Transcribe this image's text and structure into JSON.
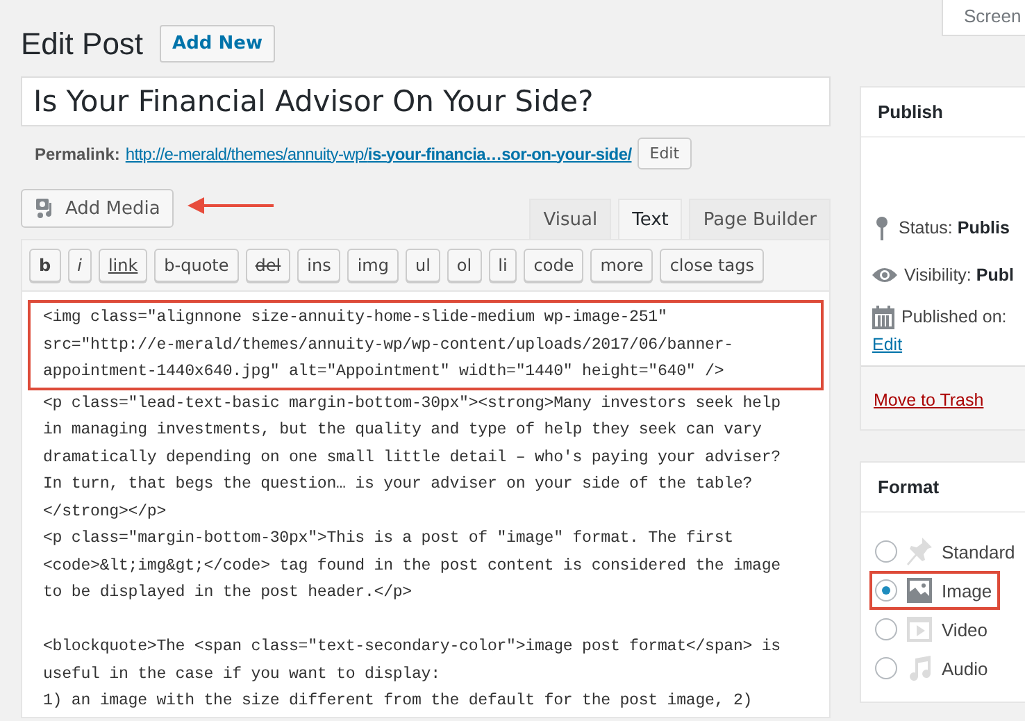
{
  "screen_options_tab": "Screen",
  "heading": {
    "title": "Edit Post",
    "add_new_button": "Add New"
  },
  "post_title": {
    "value": "Is Your Financial Advisor On Your Side?"
  },
  "permalink": {
    "label": "Permalink:",
    "url_base": "http://e-merald/themes/annuity-wp/",
    "url_slug": "is-your-financia…sor-on-your-side/",
    "edit_button": "Edit"
  },
  "add_media_button": "Add Media",
  "editor_tabs": [
    {
      "label": "Visual",
      "selected": false
    },
    {
      "label": "Text",
      "selected": true
    },
    {
      "label": "Page Builder",
      "selected": false
    }
  ],
  "quicktags": [
    {
      "label": "b",
      "kind": "bold"
    },
    {
      "label": "i",
      "kind": "italic"
    },
    {
      "label": "link",
      "kind": "underline"
    },
    {
      "label": "b-quote",
      "kind": "plain"
    },
    {
      "label": "del",
      "kind": "strike"
    },
    {
      "label": "ins",
      "kind": "plain"
    },
    {
      "label": "img",
      "kind": "plain"
    },
    {
      "label": "ul",
      "kind": "plain"
    },
    {
      "label": "ol",
      "kind": "plain"
    },
    {
      "label": "li",
      "kind": "plain"
    },
    {
      "label": "code",
      "kind": "plain"
    },
    {
      "label": "more",
      "kind": "plain"
    },
    {
      "label": "close tags",
      "kind": "plain"
    }
  ],
  "editor": {
    "highlighted_lines": [
      "<img class=\"alignnone size-annuity-home-slide-medium wp-image-251\"",
      "src=\"http://e-merald/themes/annuity-wp/wp-content/uploads/2017/06/banner-",
      "appointment-1440x640.jpg\" alt=\"Appointment\" width=\"1440\" height=\"640\" />"
    ],
    "blocks": [
      [
        "<p class=\"lead-text-basic margin-bottom-30px\"><strong>Many investors seek help",
        "in managing investments, but the quality and type of help they seek can vary",
        "dramatically depending on one small little detail – who's paying your adviser?",
        "In turn, that begs the question… is your adviser on your side of the table?",
        "</strong></p>",
        "<p class=\"margin-bottom-30px\">This is a post of \"image\" format. The first",
        "<code>&lt;img&gt;</code> tag found in the post content is considered the image",
        "to be displayed in the post header.</p>"
      ],
      [
        "<blockquote>The <span class=\"text-secondary-color\">image post format</span> is",
        "useful in the case if you want to display:",
        "1) an image with the size different from the default for the post image, 2)"
      ]
    ]
  },
  "publish_box": {
    "title": "Publish",
    "status_label": "Status:",
    "status_value": "Publis",
    "visibility_label": "Visibility:",
    "visibility_value": "Publ",
    "published_label": "Published on:",
    "edit_link": "Edit",
    "trash_link": "Move to Trash"
  },
  "format_box": {
    "title": "Format",
    "options": [
      {
        "label": "Standard",
        "kind": "standard",
        "selected": false
      },
      {
        "label": "Image",
        "kind": "image",
        "selected": true
      },
      {
        "label": "Video",
        "kind": "video",
        "selected": false
      },
      {
        "label": "Audio",
        "kind": "audio",
        "selected": false
      }
    ]
  }
}
